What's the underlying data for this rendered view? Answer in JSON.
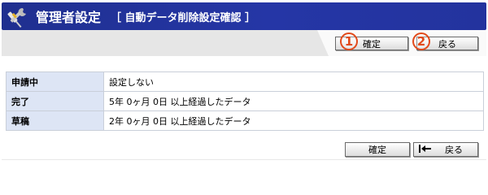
{
  "header": {
    "title": "管理者設定",
    "subtitle": "［ 自動データ削除設定確認 ］",
    "icon": "tools-icon"
  },
  "top_buttons": {
    "confirm_label": "確定",
    "back_label": "戻る",
    "confirm_marker": "1",
    "back_marker": "2"
  },
  "rows": [
    {
      "label": "申請中",
      "value": "設定しない"
    },
    {
      "label": "完了",
      "value": " 5年 0ヶ月 0日 以上経過したデータ"
    },
    {
      "label": "草稿",
      "value": " 2年 0ヶ月 0日 以上経過したデータ"
    }
  ],
  "bottom_buttons": {
    "confirm_label": "確定",
    "back_label": "戻る"
  },
  "colors": {
    "header_bg": "#2536a6",
    "label_bg": "#dde5f5",
    "marker": "#e24a1b"
  }
}
